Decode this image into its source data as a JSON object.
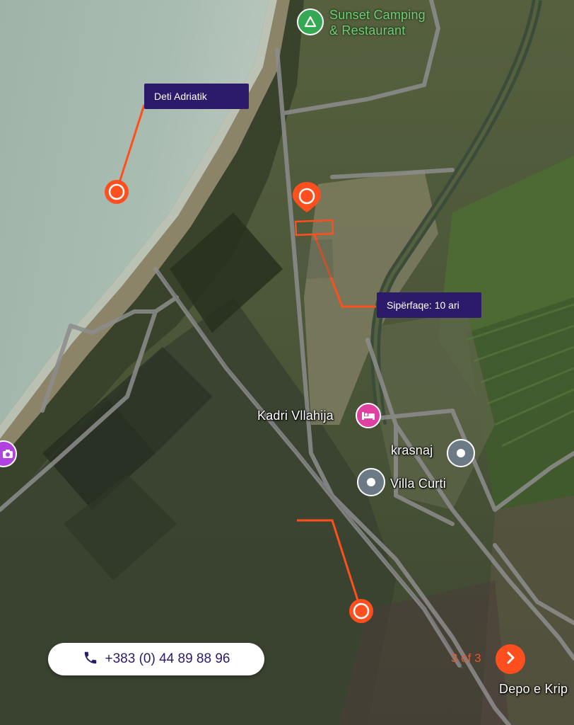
{
  "map": {
    "places": {
      "camping": "Sunset Camping\n& Restaurant",
      "kadri": "Kadri Vllahija",
      "krasnaj": "krasnaj",
      "villa": "Villa Curti",
      "depo": "Depo e Krip"
    },
    "callouts": {
      "sea": "Deti Adriatik",
      "area": "Sipërfaqe: 10 ari"
    },
    "icons": {
      "camping": "campground-icon",
      "kadri": "hotel-bed-icon",
      "krasnaj": "place-pin-icon",
      "villa": "place-pin-icon",
      "camera": "camera-icon",
      "phone": "phone-icon",
      "next": "chevron-right-icon"
    },
    "colors": {
      "accent": "#ff4f1f",
      "callout_bg": "#2c1b6b",
      "camping_green": "#34a853",
      "hotel_pink": "#e040a0",
      "poi_gray": "#6c7a86",
      "road": "#8a8a8a"
    }
  },
  "contact": {
    "phone": "+383 (0) 44 89 88 96"
  },
  "pager": {
    "counter": "3 of 3"
  }
}
